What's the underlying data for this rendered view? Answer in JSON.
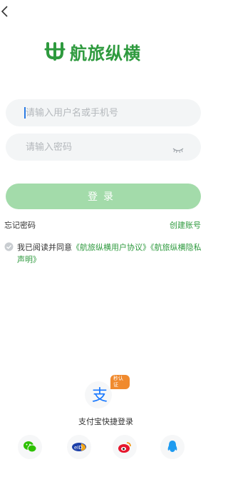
{
  "brand": {
    "name": "航旅纵横",
    "color": "#2e9a3e"
  },
  "form": {
    "username_placeholder": "请输入用户名或手机号",
    "password_placeholder": "请输入密码",
    "login_label": "登录"
  },
  "links": {
    "forgot": "忘记密码",
    "create": "创建账号"
  },
  "agreement": {
    "prefix": "我已阅读并同意",
    "user_agreement": "《航旅纵横用户协议》",
    "privacy": "《航旅纵横隐私声明》"
  },
  "alipay": {
    "badge": "秒认证",
    "label": "支付宝快捷登录"
  },
  "social": [
    "wechat-icon",
    "eid-icon",
    "weibo-icon",
    "qq-icon"
  ],
  "colors": {
    "accent": "#2e9a3e",
    "button": "#a3dbaa",
    "field_bg": "#f3f5f6"
  }
}
